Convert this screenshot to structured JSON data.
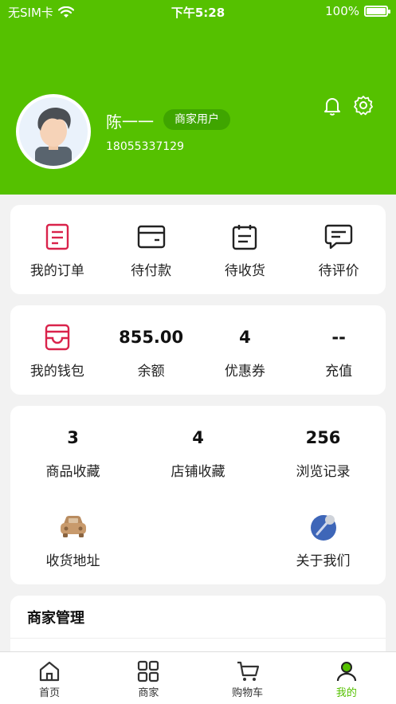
{
  "status_bar": {
    "carrier": "无SIM卡",
    "time": "下午5:28",
    "battery": "100%"
  },
  "profile": {
    "name": "陈一一",
    "role_badge": "商家用户",
    "phone": "18055337129"
  },
  "orders": [
    {
      "label": "我的订单",
      "icon": "order-list-icon"
    },
    {
      "label": "待付款",
      "icon": "wallet-card-icon"
    },
    {
      "label": "待收货",
      "icon": "calendar-receive-icon"
    },
    {
      "label": "待评价",
      "icon": "comment-icon"
    }
  ],
  "wallet": {
    "label": "我的钱包",
    "icon": "wallet-icon",
    "stats": [
      {
        "value": "855.00",
        "label": "余额"
      },
      {
        "value": "4",
        "label": "优惠券"
      },
      {
        "value": "--",
        "label": "充值"
      }
    ]
  },
  "collections": [
    {
      "value": "3",
      "label": "商品收藏"
    },
    {
      "value": "4",
      "label": "店铺收藏"
    },
    {
      "value": "256",
      "label": "浏览记录"
    }
  ],
  "services": [
    {
      "label": "收货地址",
      "icon": "car-icon"
    },
    {
      "label": "关于我们",
      "icon": "about-icon"
    }
  ],
  "merchant": {
    "title": "商家管理"
  },
  "tabbar": [
    {
      "label": "首页",
      "icon": "home-icon"
    },
    {
      "label": "商家",
      "icon": "grid-icon"
    },
    {
      "label": "购物车",
      "icon": "cart-icon"
    },
    {
      "label": "我的",
      "icon": "user-icon",
      "active": true
    }
  ],
  "colors": {
    "brand": "#55c100",
    "order_icon_red": "#d9234b"
  }
}
